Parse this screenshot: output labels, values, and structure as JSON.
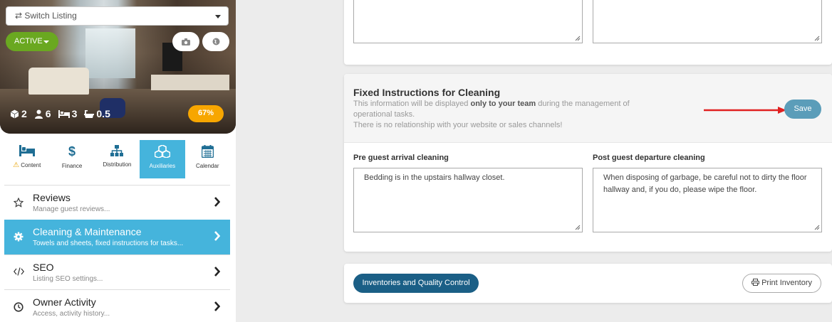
{
  "listing": {
    "switch_label": "⇄ Switch Listing",
    "status_label": "ACTIVE",
    "stats": [
      {
        "icon": "cube-icon",
        "value": "2"
      },
      {
        "icon": "users-icon",
        "value": "6"
      },
      {
        "icon": "bed-icon",
        "value": "3"
      },
      {
        "icon": "bathtub-icon",
        "value": "0.5"
      }
    ],
    "completion": "67%",
    "colors": {
      "active": "#6aa820",
      "completion": "#f7a600"
    }
  },
  "tabs": [
    {
      "label": "Content",
      "icon": "bed-icon",
      "warning": true
    },
    {
      "label": "Finance",
      "icon": "dollar-icon"
    },
    {
      "label": "Distribution",
      "icon": "sitemap-icon"
    },
    {
      "label": "Auxiliaries",
      "icon": "cubes-icon",
      "selected": true
    },
    {
      "label": "Calendar",
      "icon": "calendar-icon"
    }
  ],
  "menu": [
    {
      "title": "Reviews",
      "subtitle": "Manage guest reviews...",
      "icon": "star-icon"
    },
    {
      "title": "Cleaning & Maintenance",
      "subtitle": "Towels and sheets, fixed instructions for tasks...",
      "icon": "gear-icon",
      "selected": true
    },
    {
      "title": "SEO",
      "subtitle": "Listing SEO settings...",
      "icon": "code-icon"
    },
    {
      "title": "Owner Activity",
      "subtitle": "Access, activity history...",
      "icon": "clock-icon"
    }
  ],
  "cleaning": {
    "title": "Fixed Instructions for Cleaning",
    "desc_before": "This information will be displayed ",
    "desc_bold": "only to your team",
    "desc_after": " during the management of operational tasks.",
    "desc_line2": "There is no relationship with your website or sales channels!",
    "save_label": "Save",
    "pre_label": "Pre guest arrival cleaning",
    "pre_value": "Bedding is in the upstairs hallway closet.",
    "post_label": "Post guest departure cleaning",
    "post_value": "When disposing of garbage, be careful not to dirty the floor hallway and, if you do, please wipe the floor."
  },
  "inventory": {
    "inventories_label": "Inventories and Quality Control",
    "print_label": "Print Inventory"
  },
  "accent": "#45b4dc"
}
